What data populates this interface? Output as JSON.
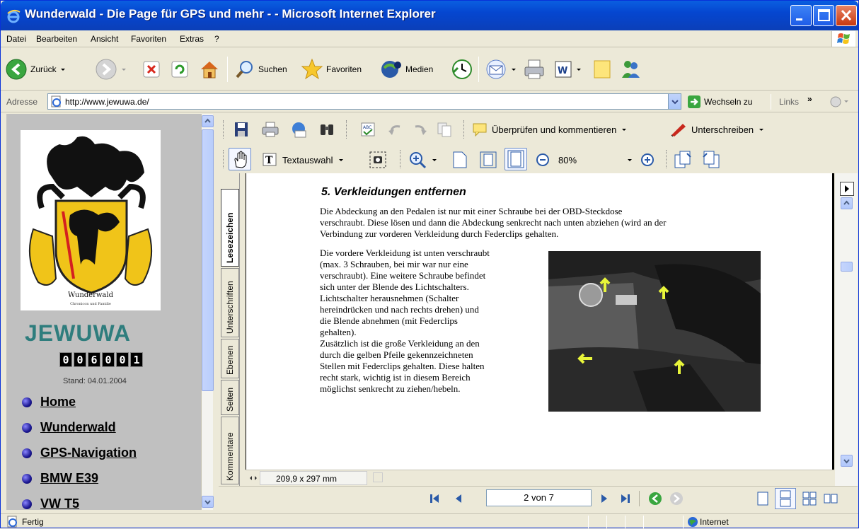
{
  "window": {
    "title": "Wunderwald - Die Page für GPS und mehr - - Microsoft Internet Explorer"
  },
  "menu": [
    "Datei",
    "Bearbeiten",
    "Ansicht",
    "Favoriten",
    "Extras",
    "?"
  ],
  "toolbar": {
    "back": "Zurück",
    "search": "Suchen",
    "favorites": "Favoriten",
    "media": "Medien"
  },
  "address": {
    "label": "Adresse",
    "url": "http://www.jewuwa.de/",
    "go": "Wechseln zu",
    "links": "Links"
  },
  "site": {
    "crest_text": "Wunderwald",
    "brand": "JEWUWA",
    "counter": [
      "0",
      "0",
      "6",
      "0",
      "0",
      "1"
    ],
    "stand": "Stand: 04.01.2004",
    "nav": [
      "Home",
      "Wunderwald",
      "GPS-Navigation",
      "BMW E39",
      "VW T5"
    ]
  },
  "pdf": {
    "review_label": "Überprüfen und kommentieren",
    "sign_label": "Unterschreiben",
    "select_label": "Textauswahl",
    "zoom": "80%",
    "tabs": [
      "Lesezeichen",
      "Unterschriften",
      "Ebenen",
      "Seiten",
      "Kommentare"
    ],
    "heading": "5. Verkleidungen entfernen",
    "para1": [
      "Die Abdeckung an den Pedalen ist nur mit einer Schraube bei der OBD-Steckdose",
      "verschraubt. Diese lösen und dann die Abdeckung senkrecht nach unten abziehen (wird an der",
      "Verbindung zur vorderen Verkleidung durch Federclips gehalten."
    ],
    "para2": [
      "Die vordere Verkleidung ist unten verschraubt",
      "(max. 3 Schrauben, bei mir war nur eine",
      "verschraubt). Eine weitere Schraube befindet",
      "sich unter der Blende des Lichtschalters.",
      "Lichtschalter herausnehmen (Schalter",
      "hereindrücken und nach rechts drehen) und",
      "die Blende abnehmen (mit Federclips",
      "gehalten).",
      "Zusätzlich ist die große Verkleidung an den",
      "durch die gelben Pfeile gekennzeichneten",
      "Stellen mit Federclips gehalten. Diese halten",
      "recht stark, wichtig ist in diesem Bereich",
      "möglichst senkrecht zu ziehen/hebeln."
    ],
    "page_size": "209,9 x 297 mm",
    "page": "2 von 7"
  },
  "status": {
    "text": "Fertig",
    "zone": "Internet"
  },
  "colors": {
    "titlebar": "#0546d0",
    "brand": "#2e7d7d",
    "chrome": "#ece9d8"
  }
}
